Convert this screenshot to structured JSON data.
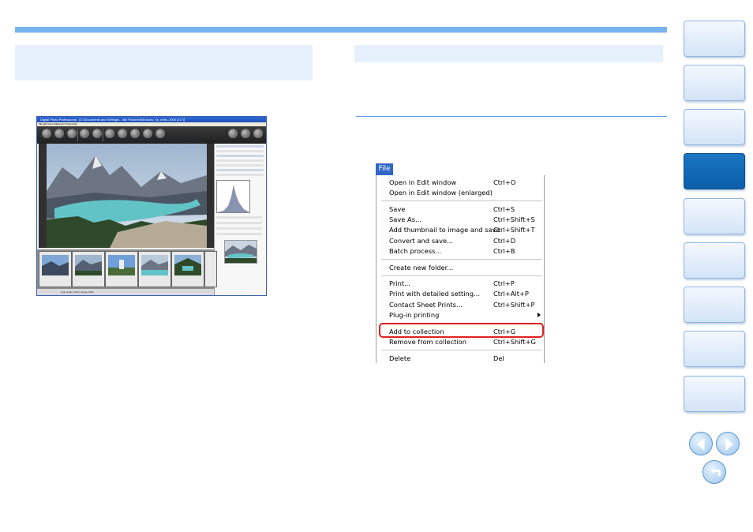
{
  "app_screenshot": {
    "window_title": "Digital Photo Professional - [C:\\Documents and Settings\\...\\My Pictures\\Windows_Xp_edits_2006 (117)]",
    "menu": "File  Edit  View  Adjustment  Tools  Help",
    "status_text": "High quality     Stitch display RGB"
  },
  "file_menu": {
    "tab_label": "File",
    "items": [
      {
        "label": "Open in Edit window",
        "shortcut": "Ctrl+O"
      },
      {
        "label": "Open in Edit window (enlarged)",
        "shortcut": ""
      },
      {
        "label": "Save",
        "shortcut": "Ctrl+S"
      },
      {
        "label": "Save As...",
        "shortcut": "Ctrl+Shift+S"
      },
      {
        "label": "Add thumbnail to image and save",
        "shortcut": "Ctrl+Shift+T"
      },
      {
        "label": "Convert and save...",
        "shortcut": "Ctrl+D"
      },
      {
        "label": "Batch process...",
        "shortcut": "Ctrl+B"
      },
      {
        "label": "Create new folder...",
        "shortcut": ""
      },
      {
        "label": "Print...",
        "shortcut": "Ctrl+P"
      },
      {
        "label": "Print with detailed setting...",
        "shortcut": "Ctrl+Alt+P"
      },
      {
        "label": "Contact Sheet Prints...",
        "shortcut": "Ctrl+Shift+P"
      },
      {
        "label": "Plug-in printing",
        "shortcut": ""
      },
      {
        "label": "Add to collection",
        "shortcut": "Ctrl+G"
      },
      {
        "label": "Remove from collection",
        "shortcut": "Ctrl+Shift+G"
      },
      {
        "label": "Delete",
        "shortcut": "Del"
      }
    ]
  },
  "colors": {
    "accent_bar": "#78b4ef",
    "heading_box": "#e6f1fd",
    "active_tab": "#0b5ea8",
    "highlight": "#e02020"
  },
  "icons": [
    "chevron-left-icon",
    "chevron-right-icon",
    "return-icon"
  ]
}
